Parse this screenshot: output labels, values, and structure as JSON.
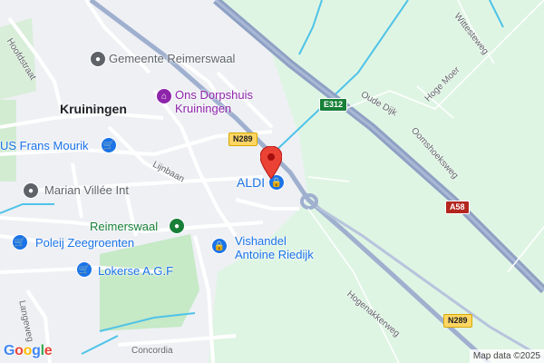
{
  "map": {
    "town": "Kruiningen",
    "places": {
      "gemeente": "Gemeente Reimerswaal",
      "dorpshuis": "Ons Dorpshuis\nKruiningen",
      "aldi": "ALDI",
      "frans": "US Frans Mourik",
      "marian": "Marian Villée Int",
      "reimerswaal": "Reimerswaal",
      "poleij": "Poleij Zeegroenten",
      "lokerse": "Lokerse A.G.F",
      "vishandel": "Vishandel\nAntoine Riedijk"
    },
    "streets": {
      "hoofdstraat": "Hoofdstraat",
      "ljinbaan": "Lijnbaan",
      "langeweg": "Langeweg",
      "concordia": "Concordia",
      "oude_dijk": "Oude Dijk",
      "hoge_moer": "Hoge Moer",
      "wittesteweg": "Wittesteweg",
      "oomshoeksweg": "Oomshoeksweg",
      "hogenakkerweg": "Hogenakkerweg"
    },
    "shields": {
      "n289_top": "N289",
      "n289_bottom": "N289",
      "e312": "E312",
      "a58": "A58"
    },
    "attribution": "Map data ©2025",
    "logo": [
      "G",
      "o",
      "o",
      "g",
      "l",
      "e"
    ],
    "colors": {
      "water": "#4fc3e8",
      "highway": "#8ea1c4",
      "urban": "#eef0f4",
      "park": "#c6e9c6",
      "marker": "#ea4335"
    }
  }
}
